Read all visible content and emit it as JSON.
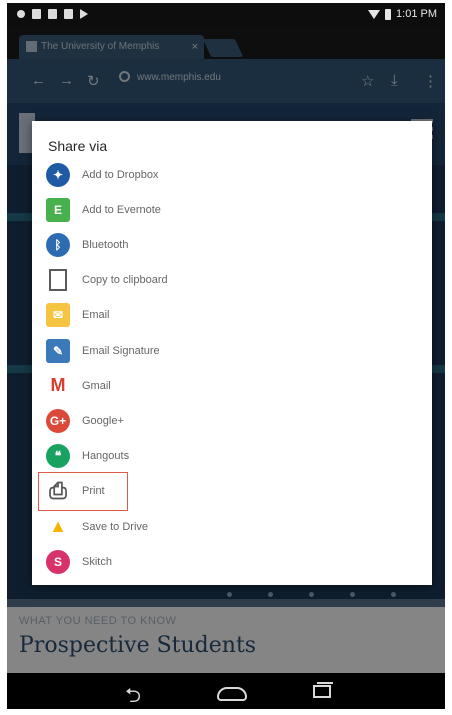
{
  "browser": {
    "tab_title": "The University of Memphis",
    "url": "www.memphis.edu"
  },
  "status_bar": {
    "time": "1:01 PM"
  },
  "page": {
    "kicker": "WHAT YOU NEED TO KNOW",
    "headline": "Prospective Students"
  },
  "share": {
    "title": "Share via",
    "items": [
      {
        "label": "Add to Dropbox",
        "icon": "dropbox-icon",
        "color": "#1f5aa5"
      },
      {
        "label": "Add to Evernote",
        "icon": "evernote-icon",
        "color": "#48b04c"
      },
      {
        "label": "Bluetooth",
        "icon": "bluetooth-icon",
        "color": "#2d6bb3"
      },
      {
        "label": "Copy to clipboard",
        "icon": "clipboard-icon",
        "color": "#5b5b5b"
      },
      {
        "label": "Email",
        "icon": "email-icon",
        "color": "#f5c542"
      },
      {
        "label": "Email Signature",
        "icon": "email-signature-icon",
        "color": "#3b79b8"
      },
      {
        "label": "Gmail",
        "icon": "gmail-icon",
        "color": "#d93b2e"
      },
      {
        "label": "Google+",
        "icon": "google-plus-icon",
        "color": "#db4a39"
      },
      {
        "label": "Hangouts",
        "icon": "hangouts-icon",
        "color": "#19a15f"
      },
      {
        "label": "Print",
        "icon": "print-icon",
        "color": "#555555",
        "highlighted": true
      },
      {
        "label": "Save to Drive",
        "icon": "drive-icon",
        "color": "#f4b400"
      },
      {
        "label": "Skitch",
        "icon": "skitch-icon",
        "color": "#d8326a"
      }
    ]
  }
}
